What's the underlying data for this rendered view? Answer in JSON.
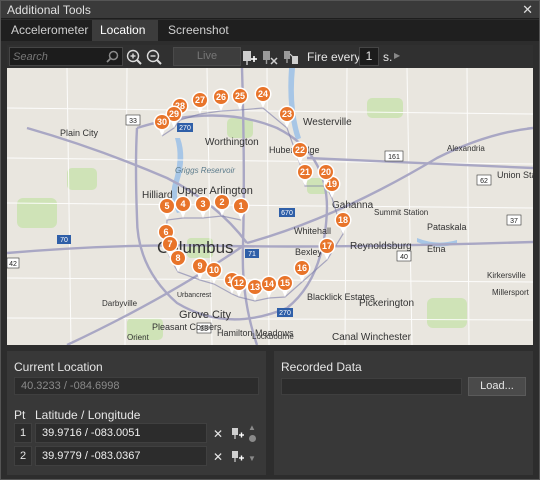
{
  "window": {
    "title": "Additional Tools",
    "close_glyph": "✕"
  },
  "tabs": [
    {
      "label": "Accelerometer",
      "active": false
    },
    {
      "label": "Location",
      "active": true
    },
    {
      "label": "Screenshot",
      "active": false
    }
  ],
  "toolbar": {
    "search_placeholder": "Search",
    "search_icon": "search-icon",
    "zoom_in_icon": "zoom-in-icon",
    "zoom_out_icon": "zoom-out-icon",
    "live_label": "Live",
    "pin_add_icon": "pin-add-icon",
    "pin_clear_icon": "pin-clear-icon",
    "route_icon": "route-icon",
    "fire_label": "Fire every",
    "fire_value": "1",
    "fire_unit": "s.",
    "play_icon": "play-icon"
  },
  "map": {
    "places": [
      "Worthington",
      "Westerville",
      "Huber Ridge",
      "Plain City",
      "Hilliard",
      "Upper Arlington",
      "Griggs Reservoir",
      "Columbus",
      "Bexley",
      "Whitehall",
      "Gahanna",
      "Blacklick Estates",
      "Reynoldsburg",
      "Summit Station",
      "Pataskala",
      "Alexandria",
      "Union Sta",
      "Etna",
      "Kirkersville",
      "Millersport",
      "Pickerington",
      "Canal Winchester",
      "Grove City",
      "Urbancrest",
      "Hamilton Meadows",
      "Pleasant Corners",
      "Lockbourne",
      "Darbyville",
      "Orient"
    ],
    "route_labels": [
      "33",
      "161",
      "62",
      "37",
      "270",
      "670",
      "71",
      "70",
      "40",
      "270",
      "33",
      "42"
    ],
    "pins": [
      "1",
      "2",
      "3",
      "4",
      "5",
      "6",
      "7",
      "8",
      "9",
      "10",
      "11",
      "12",
      "13",
      "14",
      "15",
      "16",
      "17",
      "18",
      "19",
      "20",
      "21",
      "22",
      "23",
      "24",
      "25",
      "26",
      "27",
      "28",
      "29",
      "30"
    ]
  },
  "current_location": {
    "title": "Current Location",
    "value": "40.3233 / -084.6998"
  },
  "points": {
    "col_pt": "Pt",
    "col_latlng": "Latitude / Longitude",
    "rows": [
      {
        "num": "1",
        "value": "39.9716 / -083.0051"
      },
      {
        "num": "2",
        "value": "39.9779 / -083.0367"
      }
    ],
    "remove_glyph": "✕"
  },
  "recorded_data": {
    "title": "Recorded Data",
    "load_label": "Load..."
  },
  "colors": {
    "pin": "#e8742a",
    "map_bg": "#e9e6df",
    "panel": "#383838"
  }
}
